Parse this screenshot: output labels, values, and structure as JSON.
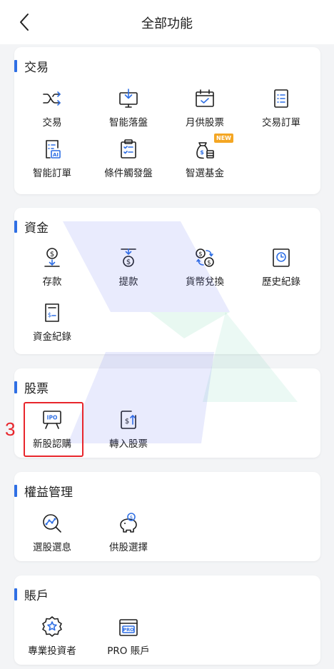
{
  "header": {
    "title": "全部功能"
  },
  "sections": {
    "trade": {
      "title": "交易",
      "items": [
        "交易",
        "智能落盤",
        "月供股票",
        "交易訂單",
        "智能訂單",
        "條件觸發盤",
        "智選基金"
      ],
      "badge": "NEW"
    },
    "funds": {
      "title": "資金",
      "items": [
        "存款",
        "提款",
        "貨幣兌換",
        "歷史紀錄",
        "資金紀錄"
      ]
    },
    "stocks": {
      "title": "股票",
      "items": [
        "新股認購",
        "轉入股票"
      ],
      "ipo_icon_text": "IPO"
    },
    "rights": {
      "title": "權益管理",
      "items": [
        "選股選息",
        "供股選擇"
      ]
    },
    "account": {
      "title": "賬戶",
      "items": [
        "專業投資者",
        "PRO 賬戶"
      ],
      "pro_icon_text": "PRO"
    }
  },
  "annotation": {
    "step": "3"
  },
  "colors": {
    "accent": "#2f6fe4",
    "highlight": "#e8262c",
    "badge": "#f4a623"
  }
}
